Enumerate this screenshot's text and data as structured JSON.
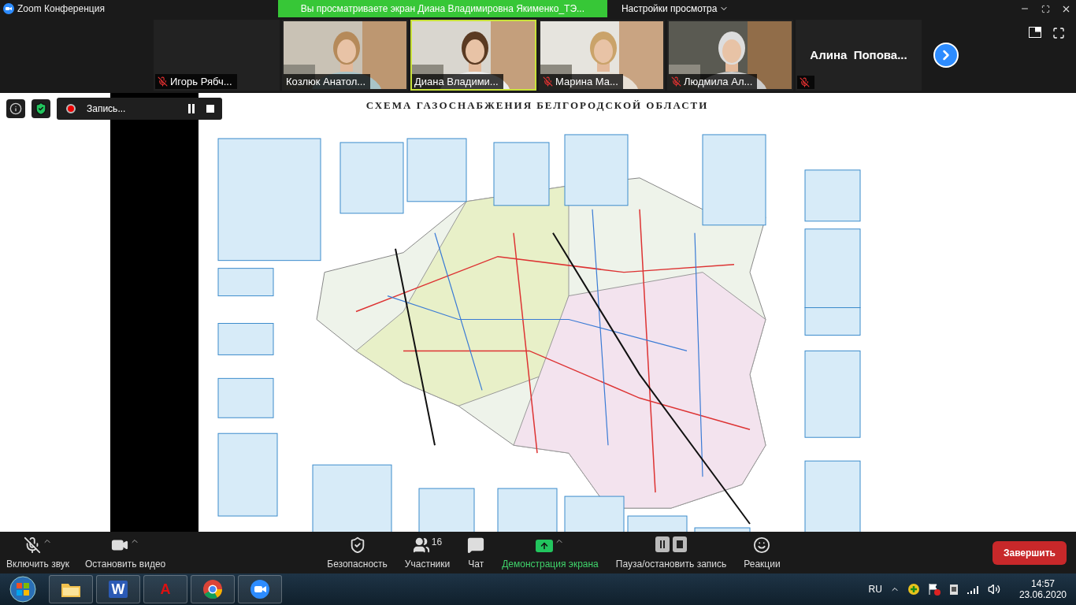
{
  "titlebar": {
    "app_title": "Zoom Конференция",
    "share_banner": "Вы просматриваете экран Диана Владимировна Якименко_ТЭ...",
    "view_options": "Настройки просмотра"
  },
  "participants": [
    {
      "name": "Игорь Рябч...",
      "muted": true,
      "kind": "name",
      "selected": false
    },
    {
      "name": "Козлюк Анатол...",
      "muted": false,
      "kind": "video",
      "selected": false
    },
    {
      "name": "Диана Владими...",
      "muted": false,
      "kind": "video",
      "selected": true
    },
    {
      "name": "Марина Ма...",
      "muted": true,
      "kind": "video",
      "selected": false
    },
    {
      "name": "Людмила Ал...",
      "muted": true,
      "kind": "video",
      "selected": false
    },
    {
      "name": "Алина  Попова...",
      "muted": true,
      "kind": "large-name",
      "selected": false
    }
  ],
  "recording": {
    "label": "Запись..."
  },
  "shared_screen": {
    "title": "СХЕМА ГАЗОСНАБЖЕНИЯ БЕЛГОРОДСКОЙ ОБЛАСТИ"
  },
  "toolbar": [
    {
      "kind": "mic",
      "label": "Включить звук",
      "muted": true,
      "caret": true
    },
    {
      "kind": "video",
      "label": "Остановить видео",
      "caret": true
    },
    {
      "kind": "security",
      "label": "Безопасность",
      "caret": false
    },
    {
      "kind": "participants",
      "label": "Участники",
      "count": "16",
      "caret": false
    },
    {
      "kind": "chat",
      "label": "Чат",
      "caret": false
    },
    {
      "kind": "share",
      "label": "Демонстрация экрана",
      "caret": true
    },
    {
      "kind": "record",
      "label": "Пауза/остановить запись",
      "caret": false
    },
    {
      "kind": "reactions",
      "label": "Реакции",
      "caret": false
    }
  ],
  "end_button": "Завершить",
  "taskbar": {
    "apps": [
      {
        "kind": "explorer"
      },
      {
        "kind": "word",
        "letter": "W"
      },
      {
        "kind": "autocad",
        "letter": "A"
      },
      {
        "kind": "chrome"
      },
      {
        "kind": "zoom"
      }
    ],
    "language": "RU",
    "time": "14:57",
    "date": "23.06.2020"
  }
}
